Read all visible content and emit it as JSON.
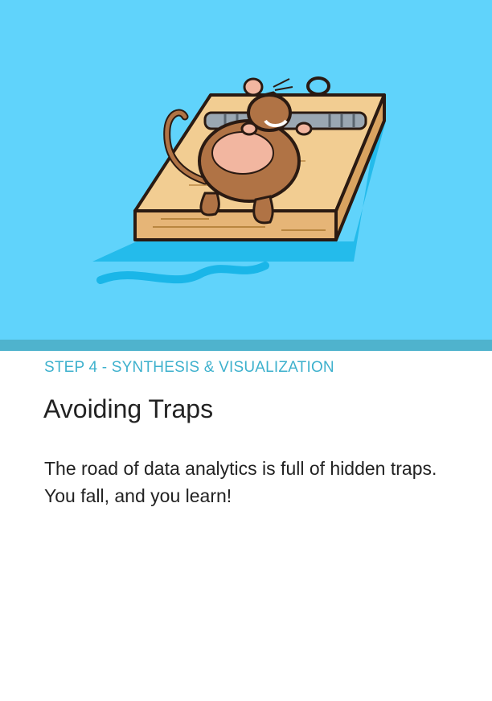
{
  "hero": {
    "illustration": "mouse-on-mousetrap",
    "background_color": "#60d3fb",
    "band_color": "#4fb3cd"
  },
  "content": {
    "step_label": "STEP 4 - SYNTHESIS & VISUALIZATION",
    "title": "Avoiding Traps",
    "description": "The road of data analytics is full of hidden traps. You fall, and you learn!"
  },
  "colors": {
    "accent": "#3eb1cd",
    "text": "#222222"
  }
}
